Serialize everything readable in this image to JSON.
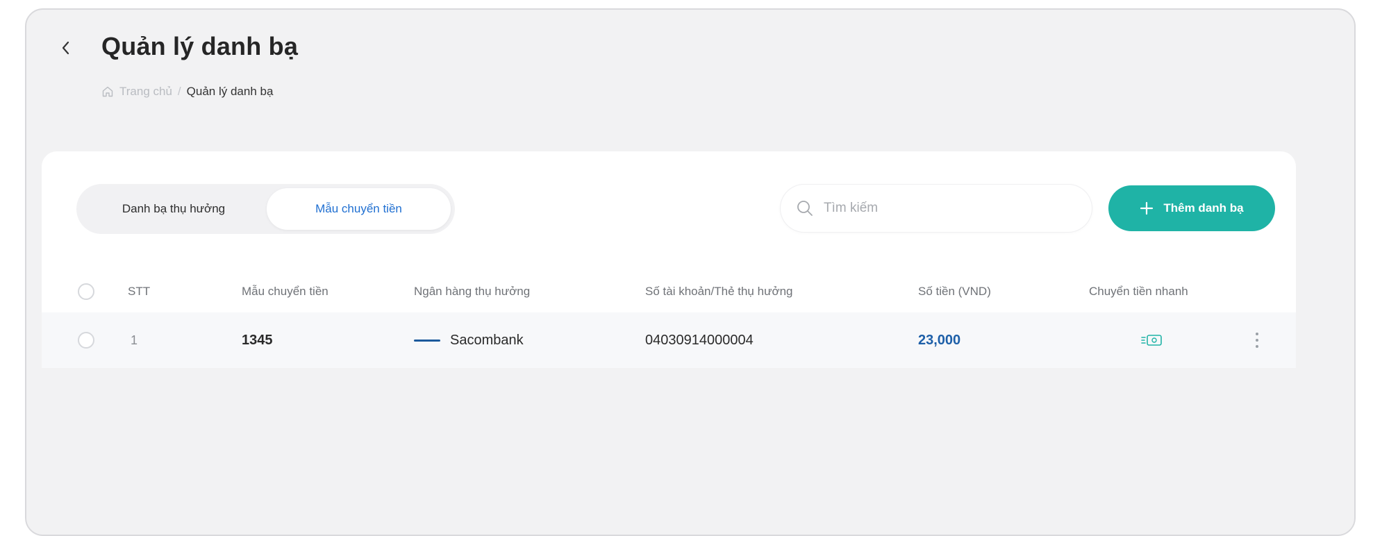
{
  "header": {
    "title": "Quản lý danh bạ",
    "breadcrumb": {
      "home": "Trang chủ",
      "separator": "/",
      "current": "Quản lý danh bạ"
    }
  },
  "tabs": [
    {
      "label": "Danh bạ thụ hưởng",
      "active": false
    },
    {
      "label": "Mẫu chuyển tiền",
      "active": true
    }
  ],
  "search": {
    "placeholder": "Tìm kiếm",
    "value": ""
  },
  "add_button": {
    "label": "Thêm danh bạ"
  },
  "table": {
    "columns": [
      "STT",
      "Mẫu chuyển tiền",
      "Ngân hàng thụ hưởng",
      "Số tài khoản/Thẻ thụ hưởng",
      "Số tiền (VND)",
      "Chuyển tiền nhanh"
    ],
    "rows": [
      {
        "stt": "1",
        "template": "1345",
        "bank": "Sacombank",
        "account": "04030914000004",
        "amount": "23,000"
      }
    ]
  },
  "colors": {
    "accent": "#1fb3a6",
    "link": "#1f6fd1",
    "amount": "#1d5fa8"
  }
}
